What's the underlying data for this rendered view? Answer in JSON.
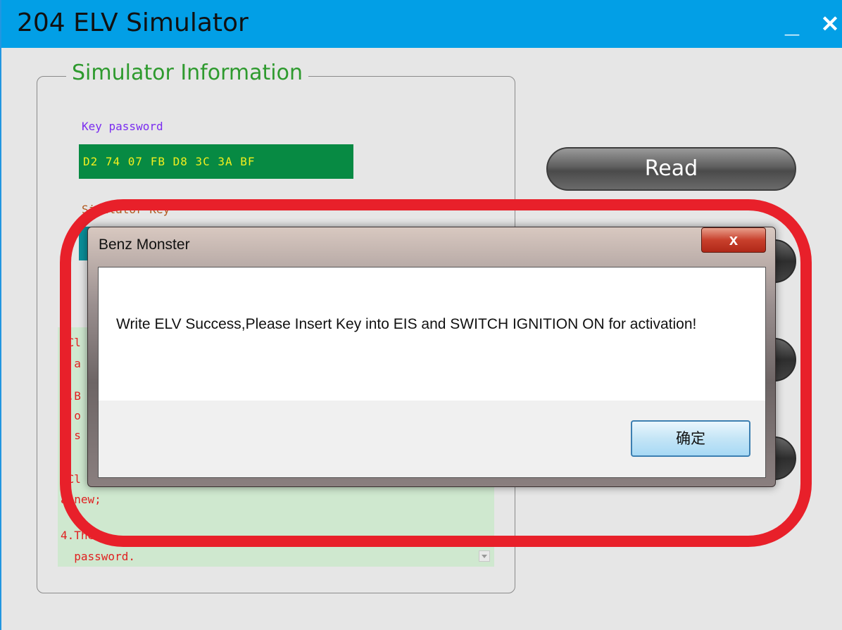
{
  "window": {
    "title": "204 ELV Simulator",
    "minimize_glyph": "_",
    "close_glyph": "✕"
  },
  "panel": {
    "legend": "Simulator Information",
    "key_password_label": "Key password",
    "key_password_value": "D2  74  07  FB  D8  3C  3A  BF",
    "simulator_key_label": "Simulator Key",
    "notes": [
      ".Cl",
      "  a",
      "2.B",
      "  o",
      "  s",
      ".Cl",
      "a new;",
      "4.The",
      "  password."
    ]
  },
  "buttons": {
    "read": "Read"
  },
  "dialog": {
    "title": "Benz Monster",
    "close_glyph": "x",
    "message": "Write ELV Success,Please Insert Key into EIS and SWITCH IGNITION ON for activation!",
    "ok_label": "确定"
  },
  "colors": {
    "titlebar": "#029fe6",
    "legend_green": "#2e9a2e",
    "key_field_bg": "#078a43",
    "key_field_text": "#f2ef1e",
    "highlight_ring": "#e8202a"
  }
}
